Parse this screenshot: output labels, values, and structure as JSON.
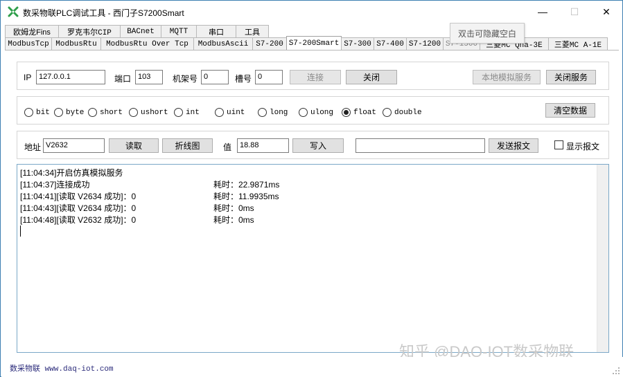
{
  "window": {
    "title": "数采物联PLC调试工具 - 西门子S7200Smart",
    "minimize": "—",
    "maximize": "☐",
    "close": "✕"
  },
  "tabs_row1": [
    "欧姆龙Fins",
    "罗克韦尔CIP",
    "BACnet",
    "MQTT",
    "串口",
    "工具"
  ],
  "tabs_row2": [
    "ModbusTcp",
    "ModbusRtu",
    "ModbusRtu Over Tcp",
    "ModbusAscii",
    "S7-200",
    "S7-200Smart",
    "S7-300",
    "S7-400",
    "S7-1200",
    "S7-1500",
    "三菱MC Qna-3E",
    "三菱MC A-1E"
  ],
  "active_tab": "S7-200Smart",
  "tooltip": "双击可隐藏空白",
  "connection": {
    "ip_label": "IP",
    "ip_value": "127.0.0.1",
    "port_label": "端口",
    "port_value": "103",
    "rack_label": "机架号",
    "rack_value": "0",
    "slot_label": "槽号",
    "slot_value": "0",
    "connect_btn": "连接",
    "close_btn": "关闭",
    "local_sim_btn": "本地模拟服务",
    "stop_service_btn": "关闭服务"
  },
  "types": {
    "options": [
      "bit",
      "byte",
      "short",
      "ushort",
      "int",
      "uint",
      "long",
      "ulong",
      "float",
      "double"
    ],
    "selected": "float",
    "clear_btn": "清空数据"
  },
  "rw": {
    "addr_label": "地址",
    "addr_value": "V2632",
    "read_btn": "读取",
    "chart_btn": "折线图",
    "value_label": "值",
    "value_value": "18.88",
    "write_btn": "写入",
    "message_value": "",
    "send_btn": "发送报文",
    "show_msg_label": "显示报文"
  },
  "log": [
    {
      "text": "[11:04:34]开启仿真模拟服务",
      "elapsed": ""
    },
    {
      "text": "[11:04:37]连接成功",
      "elapsed": "耗时：22.9871ms"
    },
    {
      "text": "[11:04:41][读取 V2634 成功]：0",
      "elapsed": "耗时：11.9935ms"
    },
    {
      "text": "[11:04:43][读取 V2634 成功]：0",
      "elapsed": "耗时：0ms"
    },
    {
      "text": "[11:04:48][读取 V2632 成功]：0",
      "elapsed": "耗时：0ms"
    }
  ],
  "status": {
    "text": "数采物联 www.daq-iot.com"
  },
  "watermark": "知乎 @DAQ-IOT数采物联"
}
